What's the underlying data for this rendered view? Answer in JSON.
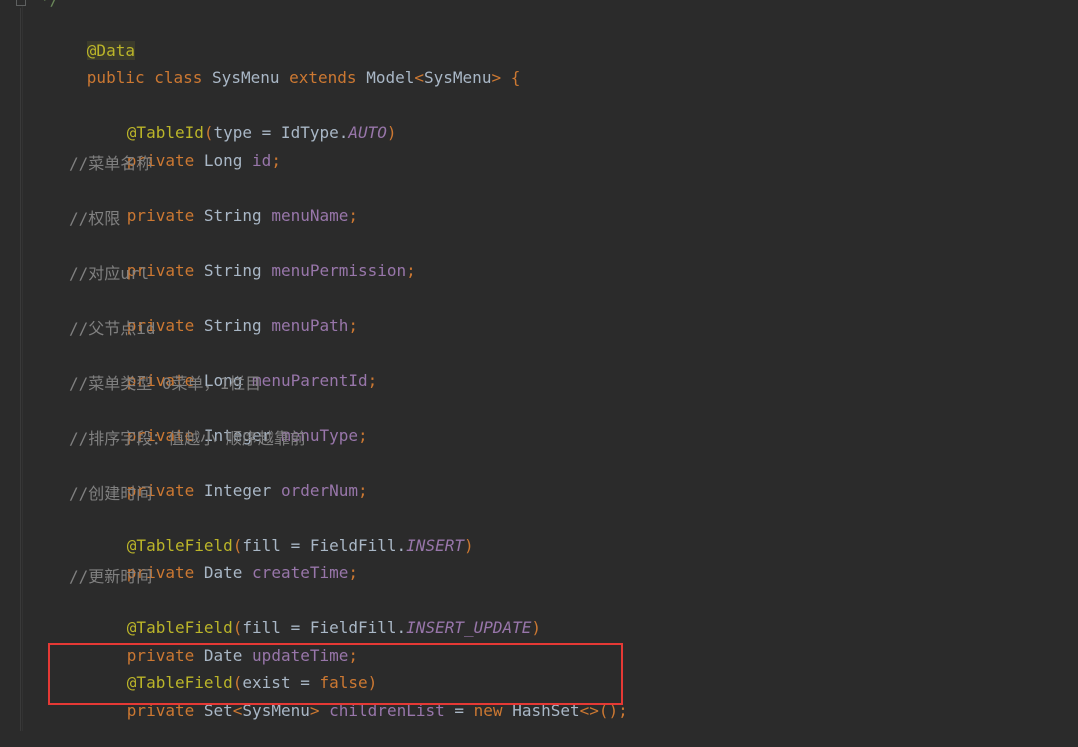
{
  "code": {
    "partial_top": "*/",
    "annotation_data": "@Data",
    "class_decl": {
      "public": "public",
      "class": "class",
      "name": "SysMenu",
      "extends": "extends",
      "parent": "Model",
      "lt": "<",
      "generic": "SysMenu",
      "gt": ">",
      "brace": "{"
    },
    "lines": [
      {
        "annotation": "@TableId",
        "open": "(",
        "arg": "type = IdType.",
        "const": "AUTO",
        "close": ")"
      },
      {
        "kw": "private",
        "type": "Long",
        "name": "id",
        "semi": ";"
      },
      {
        "comment": "//菜单名称"
      },
      {
        "kw": "private",
        "type": "String",
        "name": "menuName",
        "semi": ";"
      },
      {
        "comment": "//权限"
      },
      {
        "kw": "private",
        "type": "String",
        "name": "menuPermission",
        "semi": ";"
      },
      {
        "comment": "//对应url"
      },
      {
        "kw": "private",
        "type": "String",
        "name": "menuPath",
        "semi": ";"
      },
      {
        "comment": "//父节点id"
      },
      {
        "kw": "private",
        "type": "Long",
        "name": "menuParentId",
        "semi": ";"
      },
      {
        "comment": "//菜单类型 0菜单，1栏目"
      },
      {
        "kw": "private",
        "type": "Integer",
        "name": "menuType",
        "semi": ";"
      },
      {
        "comment": "//排序字段：值越小 顺序越靠前"
      },
      {
        "kw": "private",
        "type": "Integer",
        "name": "orderNum",
        "semi": ";"
      },
      {
        "comment": "//创建时间"
      },
      {
        "annotation": "@TableField",
        "open": "(",
        "arg": "fill = FieldFill.",
        "const": "INSERT",
        "close": ")"
      },
      {
        "kw": "private",
        "type": "Date",
        "name": "createTime",
        "semi": ";"
      },
      {
        "comment": "//更新时间"
      },
      {
        "annotation": "@TableField",
        "open": "(",
        "arg": "fill = FieldFill.",
        "const": "INSERT_UPDATE",
        "close": ")"
      },
      {
        "kw": "private",
        "type": "Date",
        "name": "updateTime",
        "semi": ";"
      }
    ],
    "highlighted": {
      "line1": {
        "annotation": "@TableField",
        "open": "(",
        "arg": "exist = ",
        "value": "false",
        "close": ")"
      },
      "line2": {
        "kw": "private",
        "type_start": "Set",
        "lt": "<",
        "generic": "SysMenu",
        "gt": ">",
        "name": "childrenList",
        "eq": " = ",
        "new": "new",
        "ctor": "HashSet",
        "diamond": "<>",
        "parens": "()",
        "semi": ";"
      }
    }
  },
  "colors": {
    "background": "#2b2b2b",
    "keyword": "#cc7832",
    "annotation": "#bbb529",
    "field": "#9876aa",
    "comment": "#808080",
    "text": "#a9b7c6",
    "highlight_border": "#e53935"
  }
}
